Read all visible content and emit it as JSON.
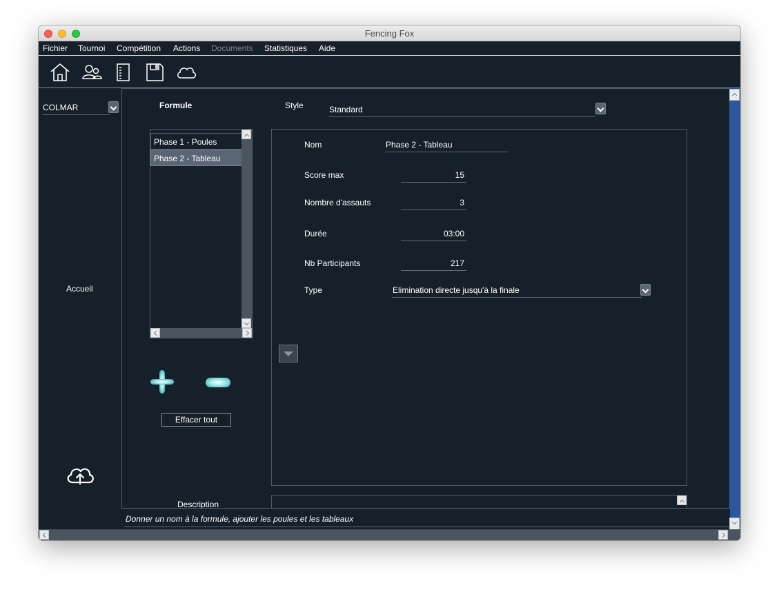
{
  "window": {
    "title": "Fencing Fox"
  },
  "menu": [
    {
      "label": "Fichier",
      "disabled": false
    },
    {
      "label": "Tournoi",
      "disabled": false
    },
    {
      "label": "Compétition",
      "disabled": false
    },
    {
      "label": "Actions",
      "disabled": false
    },
    {
      "label": "Documents",
      "disabled": true
    },
    {
      "label": "Statistiques",
      "disabled": false
    },
    {
      "label": "Aide",
      "disabled": false
    }
  ],
  "toolbar": {
    "icons": [
      "home-icon",
      "users-icon",
      "notebook-icon",
      "save-icon",
      "cloud-icon"
    ]
  },
  "sidebar": {
    "selected": "COLMAR",
    "nav_label": "Accueil",
    "upload_icon": "cloud-upload-icon"
  },
  "formule": {
    "heading": "Formule",
    "style_label": "Style",
    "style_value": "Standard",
    "phases": [
      "Phase 1 - Poules",
      "Phase 2 - Tableau"
    ],
    "selected_phase": 1,
    "clear_label": "Effacer tout"
  },
  "details": {
    "nom_label": "Nom",
    "nom_value": "Phase 2 - Tableau",
    "score_label": "Score max",
    "score_value": "15",
    "assauts_label": "Nombre d'assauts",
    "assauts_value": "3",
    "duree_label": "Durée",
    "duree_value": "03:00",
    "participants_label": "Nb Participants",
    "participants_value": "217",
    "type_label": "Type",
    "type_value": "Elimination directe jusqu'à la finale"
  },
  "description": {
    "label": "Description"
  },
  "status": {
    "message": "Donner un nom à la formule, ajouter les poules et les tableaux"
  },
  "colors": {
    "background": "#16202a",
    "accent": "#2b579e",
    "selected": "#5a6673"
  }
}
